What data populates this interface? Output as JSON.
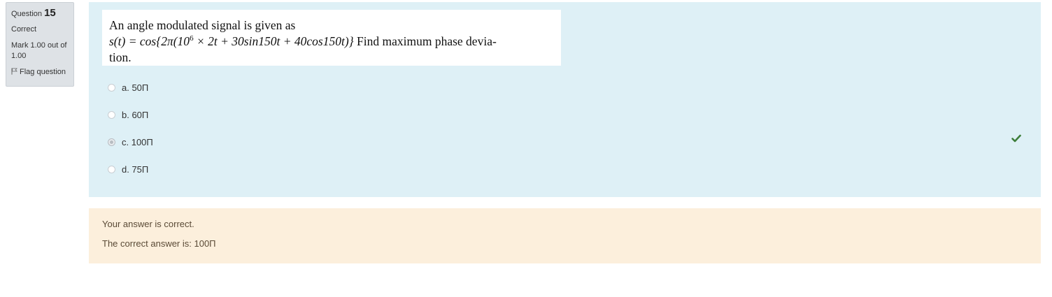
{
  "info": {
    "question_label": "Question",
    "question_number": "15",
    "state": "Correct",
    "grade": "Mark 1.00 out of 1.00",
    "flag_label": "Flag question"
  },
  "question": {
    "line1": "An angle modulated signal is given as",
    "line2_s": "s(t) = cos{2π(10",
    "line2_exp": "6",
    "line2_rest": " × 2t + 30sin150t + 40cos150t)}",
    "line2_text": " Find maximum phase devia-",
    "line3": "tion."
  },
  "answers": [
    {
      "label": "a. 50Π",
      "checked": false
    },
    {
      "label": "b. 60Π",
      "checked": false
    },
    {
      "label": "c. 100Π",
      "checked": true
    },
    {
      "label": "d. 75Π",
      "checked": false
    }
  ],
  "correct_icon": "check-icon",
  "colors": {
    "formulation_bg": "#def0f6",
    "feedback_bg": "#fcefdc",
    "info_bg": "#dee2e6",
    "correct_green": "#3d7e3a"
  },
  "feedback": {
    "specific": "Your answer is correct.",
    "right_answer": "The correct answer is: 100Π"
  }
}
